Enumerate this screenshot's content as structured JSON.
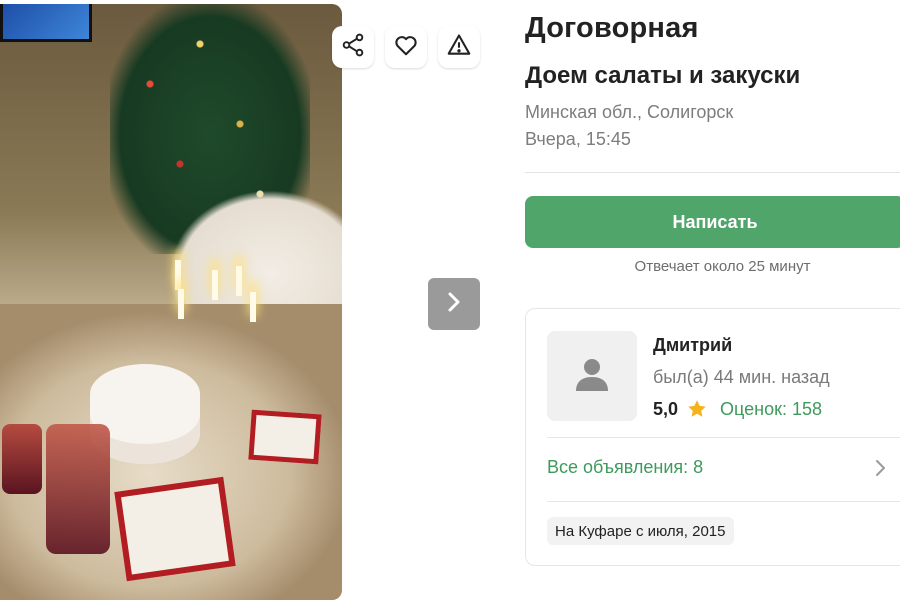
{
  "listing": {
    "price": "Договорная",
    "title": "Доем салаты и закуски",
    "location": "Минская обл., Солигорск",
    "posted": "Вчера, 15:45"
  },
  "actions": {
    "write_label": "Написать",
    "reply_time": "Отвечает около 25 минут"
  },
  "icons": {
    "share": "share-icon",
    "favorite": "heart-icon",
    "report": "warning-icon",
    "next": "chevron-right-icon",
    "avatar": "user-icon",
    "rating": "star-icon"
  },
  "seller": {
    "name": "Дмитрий",
    "last_seen": "был(а) 44 мин. назад",
    "rating": "5,0",
    "reviews": "Оценок: 158",
    "all_ads": "Все объявления: 8",
    "since": "На Куфаре с июля, 2015"
  },
  "colors": {
    "accent_green": "#4fa56a",
    "link_green": "#3e9a5c",
    "star": "#f5b21b"
  }
}
